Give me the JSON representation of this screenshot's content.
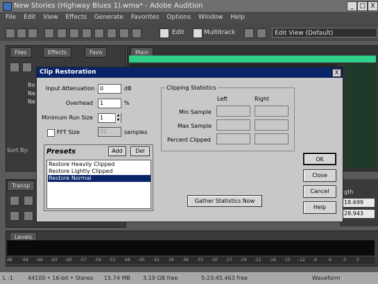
{
  "window": {
    "title": "New Stories (Highway Blues 1).wma* - Adobe Audition",
    "minimize": "_",
    "maximize": "□",
    "close": "X"
  },
  "menu": [
    "File",
    "Edit",
    "View",
    "Effects",
    "Generate",
    "Favorites",
    "Options",
    "Window",
    "Help"
  ],
  "toolbar": {
    "edit_label": "Edit",
    "multitrack_label": "Multitrack",
    "view_select": "Edit View (Default)"
  },
  "panels": {
    "files_tab": "Files",
    "effects_tab": "Effects",
    "favorites_tab": "Favo",
    "main_tab": "Main",
    "transport_tab": "Transp",
    "levels_tab": "Levels",
    "sort_by": "Sort By:",
    "file_items": [
      "Bo",
      "Ne",
      "Ne"
    ],
    "length_label": "gth",
    "time_values": [
      "18.699",
      "28.943"
    ]
  },
  "levels_ruler": [
    "dB",
    "-69",
    "-66",
    "-63",
    "-60",
    "-57",
    "-54",
    "-51",
    "-48",
    "-45",
    "-42",
    "-39",
    "-36",
    "-33",
    "-30",
    "-27",
    "-24",
    "-21",
    "-18",
    "-15",
    "-12",
    "-9",
    "-6",
    "-3",
    "0"
  ],
  "status": {
    "levels": "L  -1",
    "format": "44100 • 16-bit • Stereo",
    "size": "15.74 MB",
    "free": "3.19 GB free",
    "time_free": "5:23:45.463 free",
    "view": "Waveform"
  },
  "dialog": {
    "title": "Clip Restoration",
    "close": "X",
    "input_attenuation_label": "Input Attenuation",
    "input_attenuation_value": "0",
    "input_attenuation_unit": "dB",
    "overhead_label": "Overhead",
    "overhead_value": "1",
    "overhead_unit": "%",
    "min_run_label": "Minimum Run Size",
    "min_run_value": "1",
    "fft_label": "FFT Size",
    "fft_value": "32",
    "fft_unit": "samples",
    "presets_title": "Presets",
    "add_button": "Add",
    "del_button": "Del",
    "presets": [
      "Restore Heavily Clipped",
      "Restore Lightly Clipped",
      "Restore Normal"
    ],
    "selected_preset": 2,
    "clipping_title": "Clipping Statistics",
    "col_left": "Left",
    "col_right": "Right",
    "rows": [
      "Min Sample",
      "Max Sample",
      "Percent Clipped"
    ],
    "gather_button": "Gather Statistics Now",
    "ok_button": "OK",
    "close_button": "Close",
    "cancel_button": "Cancel",
    "help_button": "Help"
  }
}
